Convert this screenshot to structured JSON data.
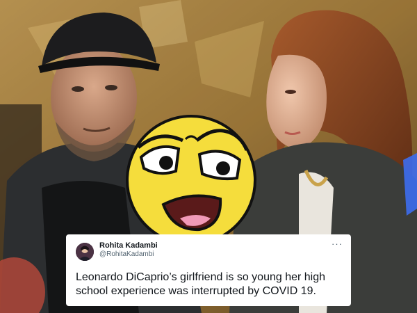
{
  "tweet": {
    "display_name": "Rohita Kadambi",
    "handle": "@RohitaKadambi",
    "text": "Leonardo DiCaprio’s girlfriend is so young her high school experience was interrupted by COVID 19.",
    "more_icon": "ellipsis-icon"
  },
  "colors": {
    "emoji_face": "#f5dd3c",
    "card_bg": "#ffffff",
    "text": "#0f1419",
    "secondary_text": "#536471"
  }
}
